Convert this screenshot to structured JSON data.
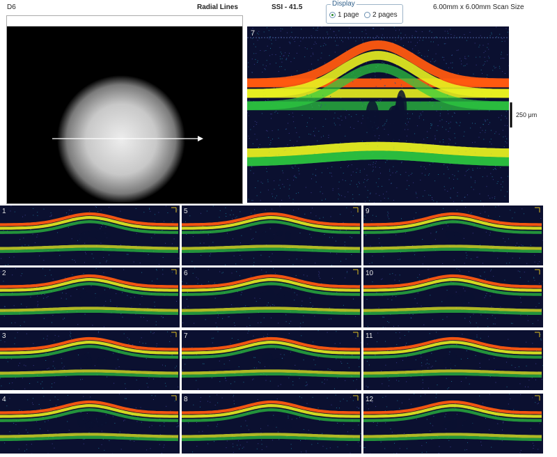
{
  "header": {
    "left_text": "D6",
    "pattern": "Radial Lines",
    "ssi": "SSI - 41.5",
    "scan_size": "6.00mm x 6.00mm Scan Size"
  },
  "display": {
    "legend": "Display",
    "options": [
      {
        "label": "1 page",
        "selected": true
      },
      {
        "label": "2 pages",
        "selected": false
      }
    ]
  },
  "main_scan": {
    "number": "7",
    "scale_label": "250 μm"
  },
  "thumbnails": [
    {
      "number": "1"
    },
    {
      "number": "2"
    },
    {
      "number": "3"
    },
    {
      "number": "4"
    },
    {
      "number": "5"
    },
    {
      "number": "6"
    },
    {
      "number": "7"
    },
    {
      "number": "8"
    },
    {
      "number": "9"
    },
    {
      "number": "10"
    },
    {
      "number": "11"
    },
    {
      "number": "12"
    }
  ],
  "colors": {
    "retina_top": "#ff5a10",
    "retina_mid": "#e8f020",
    "retina_low": "#2ecc40",
    "background": "#0b1030",
    "noise": "#1a6a8a"
  }
}
